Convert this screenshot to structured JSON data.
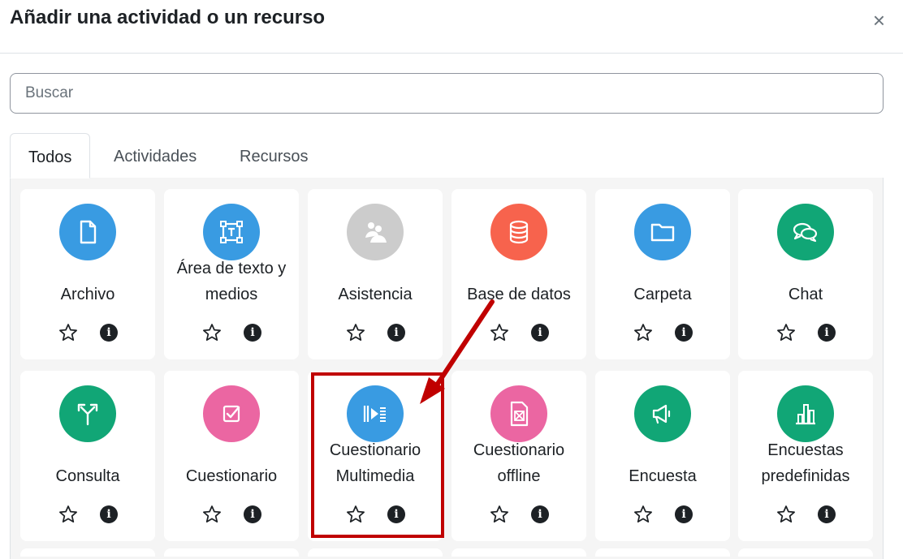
{
  "dialog": {
    "title": "Añadir una actividad o un recurso",
    "close_glyph": "×"
  },
  "search": {
    "placeholder": "Buscar"
  },
  "tabs": [
    {
      "label": "Todos",
      "active": true
    },
    {
      "label": "Actividades",
      "active": false
    },
    {
      "label": "Recursos",
      "active": false
    }
  ],
  "colors": {
    "blue": "#399be2",
    "orange": "#f7634d",
    "green": "#11a676",
    "pink": "#eb66a2",
    "gray": "#cccccc",
    "highlight": "#c00000"
  },
  "modules": [
    {
      "name": "Archivo",
      "icon": "file-icon",
      "color": "#399be2"
    },
    {
      "name": "Área de texto y medios",
      "line1": "Área de texto y",
      "line2": "medios",
      "icon": "text-area-icon",
      "color": "#399be2"
    },
    {
      "name": "Asistencia",
      "icon": "attendance-icon",
      "color": "#cccccc"
    },
    {
      "name": "Base de datos",
      "icon": "database-icon",
      "color": "#f7634d"
    },
    {
      "name": "Carpeta",
      "icon": "folder-icon",
      "color": "#399be2"
    },
    {
      "name": "Chat",
      "icon": "chat-icon",
      "color": "#11a676"
    },
    {
      "name": "Consulta",
      "icon": "choice-icon",
      "color": "#11a676"
    },
    {
      "name": "Cuestionario",
      "icon": "quiz-icon",
      "color": "#eb66a2"
    },
    {
      "name": "Cuestionario Multimedia",
      "line1": "Cuestionario",
      "line2": "Multimedia",
      "icon": "video-quiz-icon",
      "color": "#399be2"
    },
    {
      "name": "Cuestionario offline",
      "line1": "Cuestionario",
      "line2": "offline",
      "icon": "offline-quiz-icon",
      "color": "#eb66a2"
    },
    {
      "name": "Encuesta",
      "icon": "megaphone-icon",
      "color": "#11a676"
    },
    {
      "name": "Encuestas predefinidas",
      "line1": "Encuestas",
      "line2": "predefinidas",
      "icon": "bar-chart-icon",
      "color": "#11a676"
    }
  ],
  "action_icons": {
    "star": "star-outline-icon",
    "info": "info-icon",
    "info_glyph": "i"
  },
  "annotation": {
    "highlighted_module": "Cuestionario Multimedia"
  }
}
